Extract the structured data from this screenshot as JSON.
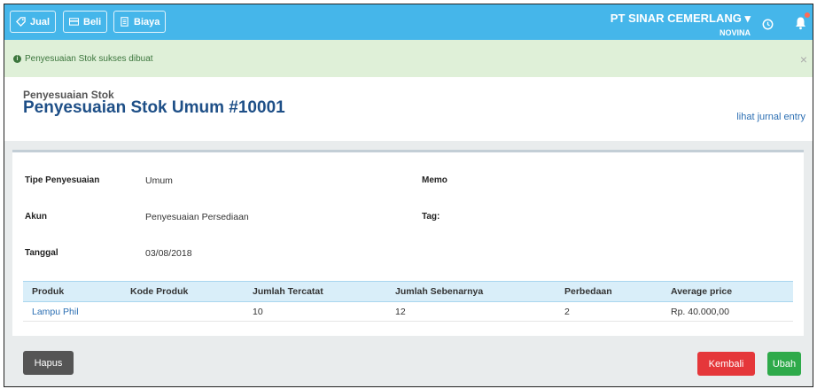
{
  "topbar": {
    "nav": [
      {
        "label": "Jual",
        "icon": "tag-icon"
      },
      {
        "label": "Beli",
        "icon": "credit-card-icon"
      },
      {
        "label": "Biaya",
        "icon": "receipt-icon"
      }
    ],
    "company_name": "PT SINAR CEMERLANG ▾",
    "user_name": "NOVINA"
  },
  "alert": {
    "message": "Penyesuaian Stok sukses dibuat",
    "close": "×"
  },
  "header": {
    "subtitle": "Penyesuaian Stok",
    "title": "Penyesuaian Stok Umum #10001",
    "journal_link": "lihat jurnal entry"
  },
  "details": {
    "type_label": "Tipe Penyesuaian",
    "type_value": "Umum",
    "account_label": "Akun",
    "account_value": "Penyesuaian Persediaan",
    "date_label": "Tanggal",
    "date_value": "03/08/2018",
    "memo_label": "Memo",
    "tag_label": "Tag:"
  },
  "table": {
    "headers": [
      "Produk",
      "Kode Produk",
      "Jumlah Tercatat",
      "Jumlah Sebenarnya",
      "Perbedaan",
      "Average price"
    ],
    "rows": [
      [
        "Lampu Phil",
        "",
        "10",
        "12",
        "2",
        "Rp. 40.000,00"
      ]
    ]
  },
  "actions": {
    "delete": "Hapus",
    "back": "Kembali",
    "edit": "Ubah"
  },
  "colors": {
    "topbar": "#45b6ea",
    "alert_bg": "#dff0d8",
    "title": "#1e4f87",
    "back_button": "#e5373a",
    "edit_button": "#2eaa4a",
    "delete_button": "#555555"
  }
}
